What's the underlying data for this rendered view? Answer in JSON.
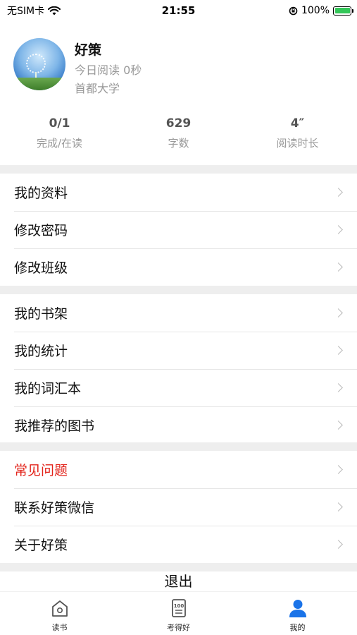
{
  "status_bar": {
    "carrier": "无SIM卡",
    "time": "21:55",
    "battery": "100%"
  },
  "profile": {
    "name": "好策",
    "today_reading": "今日阅读 0秒",
    "school": "首都大学"
  },
  "stats": [
    {
      "value": "0/1",
      "label": "完成/在读"
    },
    {
      "value": "629",
      "label": "字数"
    },
    {
      "value": "4″",
      "label": "阅读时长"
    }
  ],
  "menu_group_1": [
    {
      "label": "我的资料"
    },
    {
      "label": "修改密码"
    },
    {
      "label": "修改班级"
    }
  ],
  "menu_group_2": [
    {
      "label": "我的书架"
    },
    {
      "label": "我的统计"
    },
    {
      "label": "我的词汇本"
    },
    {
      "label": "我推荐的图书"
    }
  ],
  "menu_group_3": [
    {
      "label": "常见问题",
      "color": "#e2231a"
    },
    {
      "label": "联系好策微信"
    },
    {
      "label": "关于好策"
    }
  ],
  "logout_label": "退出",
  "tabbar": [
    {
      "label": "读书",
      "icon": "home-icon"
    },
    {
      "label": "考得好",
      "icon": "score-card-icon"
    },
    {
      "label": "我的",
      "icon": "user-icon",
      "active": true,
      "color": "#1a73e8"
    }
  ]
}
